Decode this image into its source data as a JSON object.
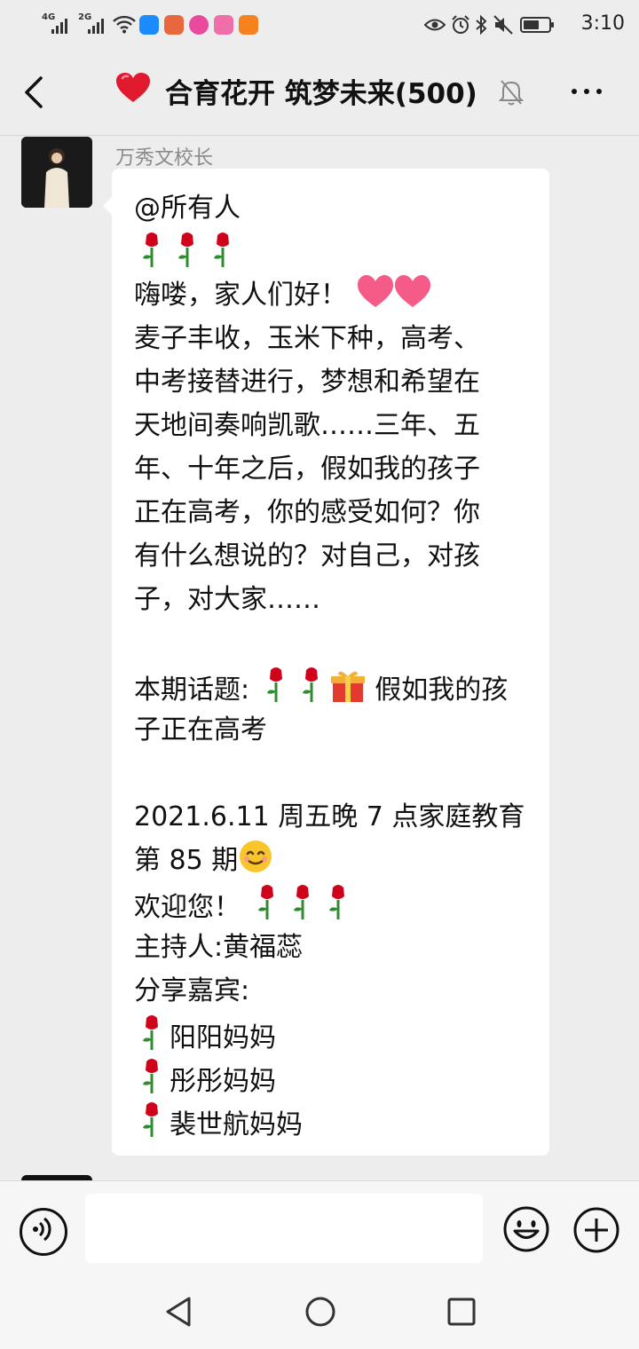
{
  "status_bar": {
    "network1": "4G",
    "network2": "2G",
    "time": "3:10"
  },
  "chat_header": {
    "title": "合育花开 筑梦未来(500)"
  },
  "message": {
    "sender": "万秀文校长",
    "lines": [
      "@所有人",
      "🌹🌹🌹",
      "嗨喽，家人们好！",
      "麦子丰收，玉米下种，高考、",
      "中考接替进行，梦想和希望在",
      "天地间奏响凯歌……三年、五",
      "年、十年之后，假如我的孩子",
      "正在高考，你的感受如何？你",
      "有什么想说的？对自己，对孩",
      "子，对大家……",
      "",
      "本期话题:",
      "假如我的孩",
      "子正在高考",
      "",
      "2021.6.11 周五晚 7 点家庭教育",
      "第 85 期",
      "欢迎您！",
      "主持人:黄福蕊",
      "分享嘉宾:",
      "阳阳妈妈",
      "彤彤妈妈",
      "裴世航妈妈"
    ]
  },
  "colors": {
    "background": "#ededed",
    "bubble": "#ffffff",
    "heart": "#e0192f",
    "rose": "#d0021b"
  }
}
